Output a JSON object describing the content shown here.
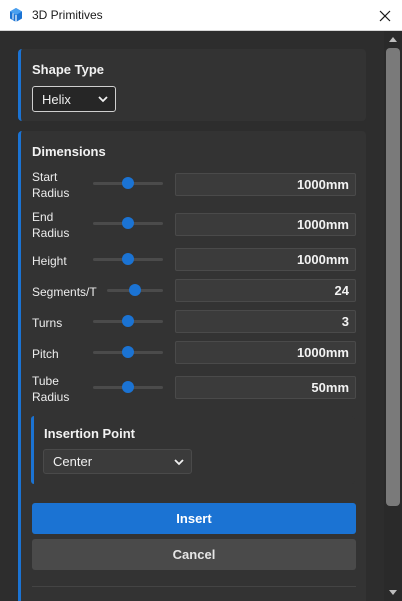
{
  "window": {
    "title": "3D Primitives",
    "close_icon": "close-icon",
    "app_icon": "3d-primitives-icon"
  },
  "shape_type": {
    "heading": "Shape Type",
    "selected": "Helix"
  },
  "dimensions": {
    "heading": "Dimensions",
    "rows": [
      {
        "label": "Start Radius",
        "value": "1000mm",
        "slider_level": 0.5
      },
      {
        "label": "End Radius",
        "value": "1000mm",
        "slider_level": 0.5
      },
      {
        "label": "Height",
        "value": "1000mm",
        "slider_level": 0.5
      },
      {
        "label": "Segments/T",
        "value": "24",
        "slider_level": 0.5
      },
      {
        "label": "Turns",
        "value": "3",
        "slider_level": 0.5
      },
      {
        "label": "Pitch",
        "value": "1000mm",
        "slider_level": 0.5
      },
      {
        "label": "Tube Radius",
        "value": "50mm",
        "slider_level": 0.5
      }
    ]
  },
  "insertion_point": {
    "heading": "Insertion Point",
    "selected": "Center"
  },
  "actions": {
    "insert_label": "Insert",
    "cancel_label": "Cancel"
  },
  "colors": {
    "accent": "#1b73d3",
    "background": "#2d2d2d",
    "panel": "#333333"
  }
}
